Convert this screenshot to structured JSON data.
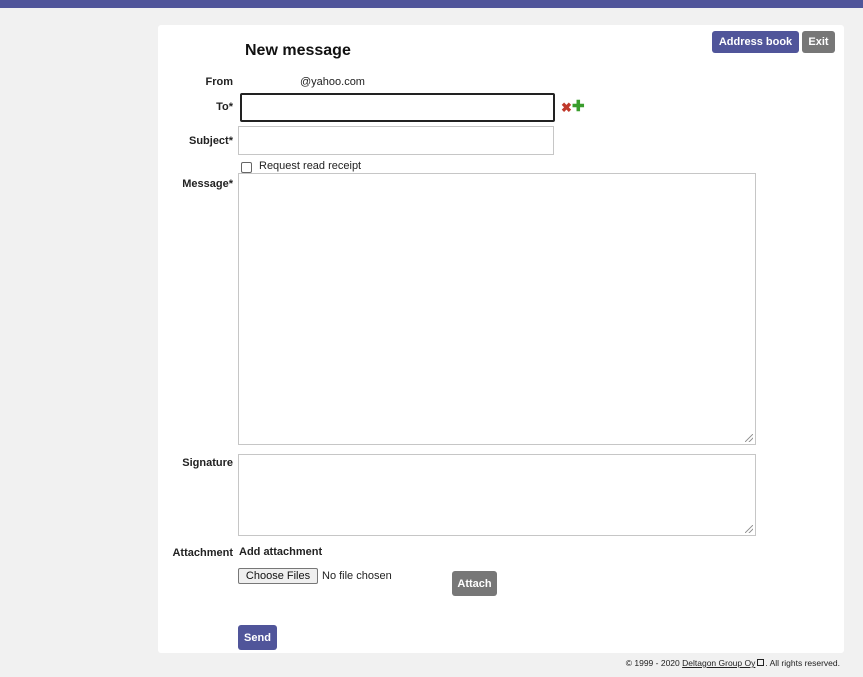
{
  "header": {
    "title": "New message",
    "address_book_label": "Address book",
    "exit_label": "Exit"
  },
  "form": {
    "from_label": "From",
    "from_value": "@yahoo.com",
    "to_label": "To*",
    "to_value": "",
    "subject_label": "Subject*",
    "subject_value": "",
    "read_receipt_label": "Request read receipt",
    "read_receipt_checked": false,
    "message_label": "Message*",
    "message_value": "",
    "signature_label": "Signature",
    "signature_value": "",
    "attachment_label": "Attachment",
    "add_attachment_label": "Add attachment",
    "choose_files_label": "Choose Files",
    "no_file_label": "No file chosen",
    "attach_label": "Attach",
    "send_label": "Send"
  },
  "footer": {
    "copyright": "© 1999 - 2020",
    "company_link": "Deltagon Group Oy",
    "rights": ". All rights reserved."
  },
  "colors": {
    "accent": "#50559a",
    "grey_button": "#777777",
    "remove_icon": "#c0392b",
    "add_icon": "#3a9d2d"
  },
  "icons": [
    "remove-recipient-icon",
    "add-recipient-icon",
    "external-link-icon",
    "resize-handle-icon"
  ]
}
